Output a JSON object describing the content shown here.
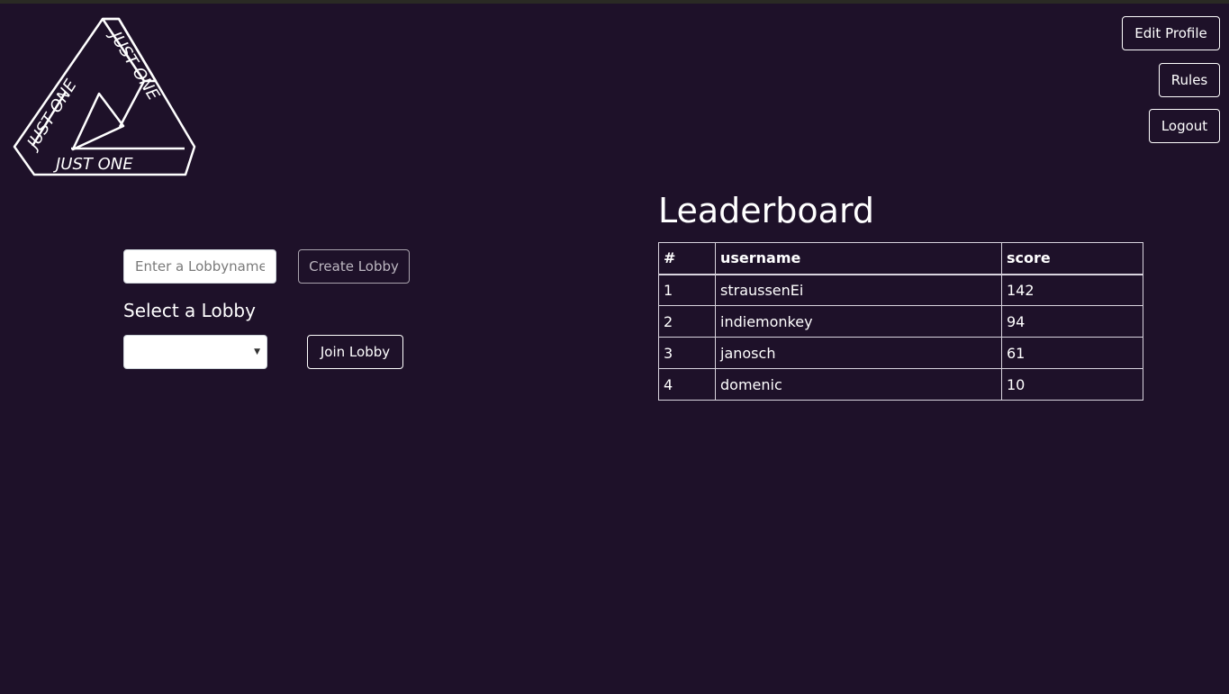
{
  "logo": {
    "text": "JUST ONE",
    "name": "just-one-logo"
  },
  "nav": {
    "edit_profile": "Edit Profile",
    "rules": "Rules",
    "logout": "Logout"
  },
  "lobby": {
    "name_placeholder": "Enter a Lobbyname",
    "create_label": "Create Lobby",
    "select_heading": "Select a Lobby",
    "selected_value": "",
    "join_label": "Join Lobby"
  },
  "leaderboard": {
    "title": "Leaderboard",
    "columns": [
      "#",
      "username",
      "score"
    ],
    "rows": [
      [
        "1",
        "straussenEi",
        "142"
      ],
      [
        "2",
        "indiemonkey",
        "94"
      ],
      [
        "3",
        "janosch",
        "61"
      ],
      [
        "4",
        "domenic",
        "10"
      ]
    ]
  },
  "colors": {
    "background": "#1e1129",
    "text": "#ffffff",
    "border": "#d9d4de"
  }
}
